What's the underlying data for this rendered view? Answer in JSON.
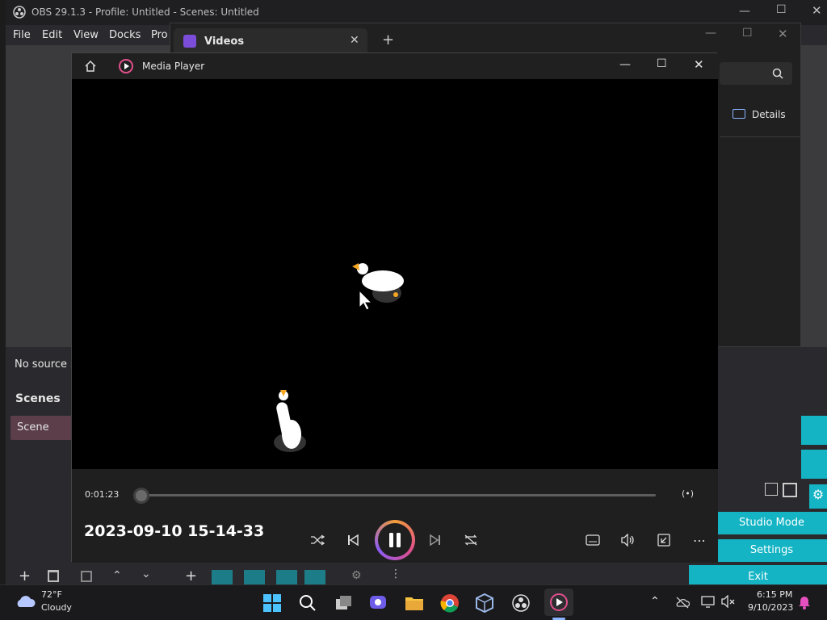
{
  "obs": {
    "title": "OBS 29.1.3 - Profile: Untitled - Scenes: Untitled",
    "menu": [
      "File",
      "Edit",
      "View",
      "Docks",
      "Pro"
    ],
    "no_source_text": "No source s",
    "scenes_header": "Scenes",
    "scene_item": "Scene",
    "buttons": {
      "studio_mode": "Studio Mode",
      "settings": "Settings",
      "exit": "Exit"
    }
  },
  "videos_window": {
    "tab_label": "Videos",
    "details_label": "Details"
  },
  "media_player": {
    "title": "Media Player",
    "time": "0:01:23",
    "file_name": "2023-09-10 15-14-33",
    "accent_color": "#e14f8c"
  },
  "taskbar": {
    "weather_temp": "72°F",
    "weather_desc": "Cloudy",
    "clock_time": "6:15 PM",
    "clock_date": "9/10/2023"
  }
}
